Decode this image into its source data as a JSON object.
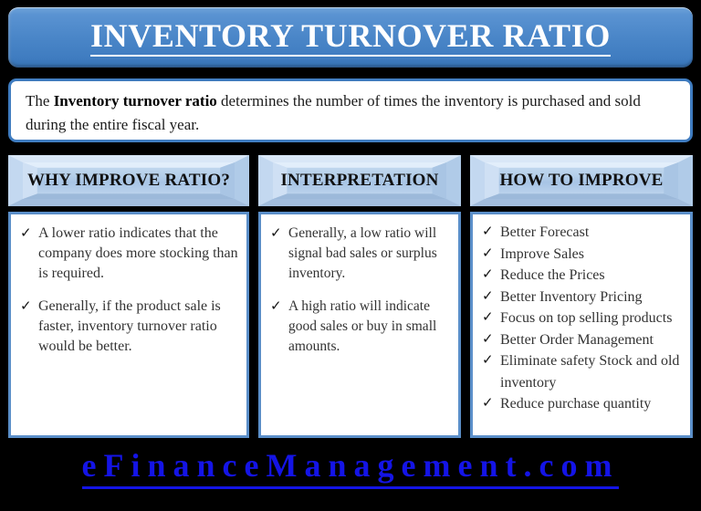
{
  "title": {
    "text": "INVENTORY TURNOVER RATIO"
  },
  "description": {
    "lead": "The ",
    "emphasis": "Inventory turnover ratio",
    "rest": " determines the number of times the inventory is purchased and sold during the entire fiscal year."
  },
  "columns": [
    {
      "header": "WHY IMPROVE RATIO?",
      "items": [
        "A lower ratio indicates that the company does more stocking than is required.",
        "Generally, if the product sale is faster, inventory turnover ratio would be better."
      ]
    },
    {
      "header": "INTERPRETATION",
      "items": [
        "Generally, a low ratio will signal bad sales or surplus inventory.",
        "A high ratio will indicate good sales or buy in small amounts."
      ]
    },
    {
      "header": "HOW TO IMPROVE",
      "items": [
        "Better Forecast",
        "Improve Sales",
        "Reduce the Prices",
        "Better Inventory Pricing",
        "Focus on top selling products",
        "Better Order Management",
        "Eliminate safety Stock and old inventory",
        "Reduce purchase quantity"
      ]
    }
  ],
  "bullet_glyph": "✓",
  "footer": {
    "brand": "eFinanceManagement.com"
  },
  "colors": {
    "background": "#000000",
    "title_banner": "#4a86c8",
    "title_text": "#ffffff",
    "header_banner": "#b6d0ea",
    "header_text": "#111111",
    "content_border": "#5b8fc9",
    "content_background": "#ffffff",
    "body_text": "#333333",
    "footer_brand": "#1414e6"
  }
}
